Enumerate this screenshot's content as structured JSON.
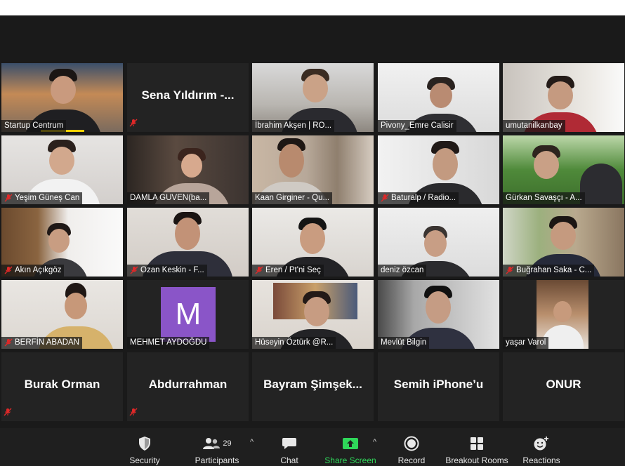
{
  "participants": [
    {
      "name": "Startup Centrum",
      "muted": false,
      "type": "video",
      "speaking": true
    },
    {
      "name": "Sena Yıldırım -...",
      "muted": true,
      "type": "name"
    },
    {
      "name": "İbrahim Akşen | RO...",
      "muted": false,
      "type": "video"
    },
    {
      "name": "Pivony_Emre Calisir",
      "muted": false,
      "type": "video"
    },
    {
      "name": "umutanilkanbay",
      "muted": false,
      "type": "video"
    },
    {
      "name": "Yeşim Güneş Can",
      "muted": true,
      "type": "video"
    },
    {
      "name": "DAMLA GUVEN(ba...",
      "muted": false,
      "type": "video"
    },
    {
      "name": "Kaan Girginer - Qu...",
      "muted": false,
      "type": "video",
      "highlight": true
    },
    {
      "name": "Baturalp / Radio...",
      "muted": true,
      "type": "video"
    },
    {
      "name": "Gürkan Savaşçı - A...",
      "muted": false,
      "type": "video"
    },
    {
      "name": "Akın Açıkgöz",
      "muted": true,
      "type": "video"
    },
    {
      "name": "Ozan Keskin - F...",
      "muted": true,
      "type": "video"
    },
    {
      "name": "Eren / Pt'ni Seç",
      "muted": true,
      "type": "video"
    },
    {
      "name": "deniz özcan",
      "muted": false,
      "type": "video"
    },
    {
      "name": "Buğrahan Saka - C...",
      "muted": true,
      "type": "video"
    },
    {
      "name": "BERFİN ABADAN",
      "muted": true,
      "type": "video"
    },
    {
      "name": "MEHMET AYDOĞDU",
      "muted": false,
      "type": "avatar",
      "initial": "M"
    },
    {
      "name": "Hüseyin Öztürk @R...",
      "muted": false,
      "type": "video"
    },
    {
      "name": "Mevlüt Bilgin",
      "muted": false,
      "type": "video"
    },
    {
      "name": "yaşar Varol",
      "muted": false,
      "type": "video"
    },
    {
      "name": "Burak Orman",
      "muted": true,
      "type": "name"
    },
    {
      "name": "Abdurrahman",
      "muted": true,
      "type": "name"
    },
    {
      "name": "Bayram  Şimşek...",
      "muted": false,
      "type": "name"
    },
    {
      "name": "Semih iPhone’u",
      "muted": false,
      "type": "name"
    },
    {
      "name": "ONUR",
      "muted": false,
      "type": "name"
    }
  ],
  "toolbar": {
    "security": {
      "label": "Security",
      "icon": "shield-icon"
    },
    "participants": {
      "label": "Participants",
      "icon": "participants-icon",
      "count": "29"
    },
    "chat": {
      "label": "Chat",
      "icon": "chat-icon"
    },
    "share": {
      "label": "Share Screen",
      "icon": "share-screen-icon"
    },
    "record": {
      "label": "Record",
      "icon": "record-icon"
    },
    "breakout": {
      "label": "Breakout Rooms",
      "icon": "breakout-rooms-icon"
    },
    "reactions": {
      "label": "Reactions",
      "icon": "reactions-icon"
    }
  },
  "colors": {
    "background": "#1a1a1a",
    "tile": "#2b2b2b",
    "active_speaker": "#b6d93a",
    "speaking_bar": "#f0d000",
    "share_green": "#2fd75a",
    "mute_red": "#e02828",
    "avatar_purple": "#8a55c8"
  }
}
